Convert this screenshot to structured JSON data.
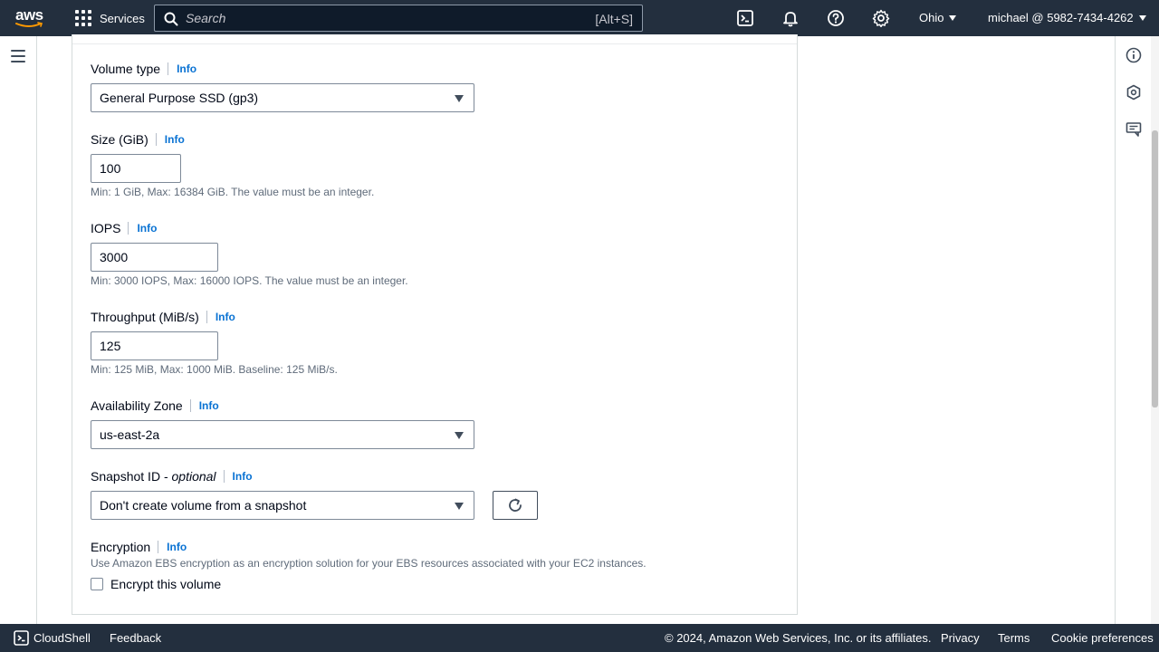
{
  "topnav": {
    "logo_text": "aws",
    "services_label": "Services",
    "search_placeholder": "Search",
    "search_shortcut": "[Alt+S]",
    "region": "Ohio",
    "account": "michael @ 5982-7434-4262",
    "icons": [
      "cloudshell-icon",
      "bell-icon",
      "help-icon",
      "gear-icon"
    ]
  },
  "form": {
    "info_label": "Info",
    "volume_type": {
      "label": "Volume type",
      "value": "General Purpose SSD (gp3)"
    },
    "size": {
      "label": "Size (GiB)",
      "value": "100",
      "hint": "Min: 1 GiB, Max: 16384 GiB. The value must be an integer."
    },
    "iops": {
      "label": "IOPS",
      "value": "3000",
      "hint": "Min: 3000 IOPS, Max: 16000 IOPS. The value must be an integer."
    },
    "throughput": {
      "label": "Throughput (MiB/s)",
      "value": "125",
      "hint": "Min: 125 MiB, Max: 1000 MiB. Baseline: 125 MiB/s."
    },
    "availability_zone": {
      "label": "Availability Zone",
      "value": "us-east-2a"
    },
    "snapshot": {
      "label": "Snapshot ID - ",
      "label_optional": "optional",
      "value": "Don't create volume from a snapshot"
    },
    "encryption": {
      "label": "Encryption",
      "description": "Use Amazon EBS encryption as an encryption solution for your EBS resources associated with your EC2 instances.",
      "checkbox_label": "Encrypt this volume",
      "checked": false
    }
  },
  "footer": {
    "cloudshell": "CloudShell",
    "feedback": "Feedback",
    "copyright": "© 2024, Amazon Web Services, Inc. or its affiliates.",
    "privacy": "Privacy",
    "terms": "Terms",
    "cookies": "Cookie preferences"
  },
  "colors": {
    "nav_bg": "#232f3e",
    "link_blue": "#0972d3",
    "text": "#000716",
    "hint": "#5f6b7a"
  }
}
